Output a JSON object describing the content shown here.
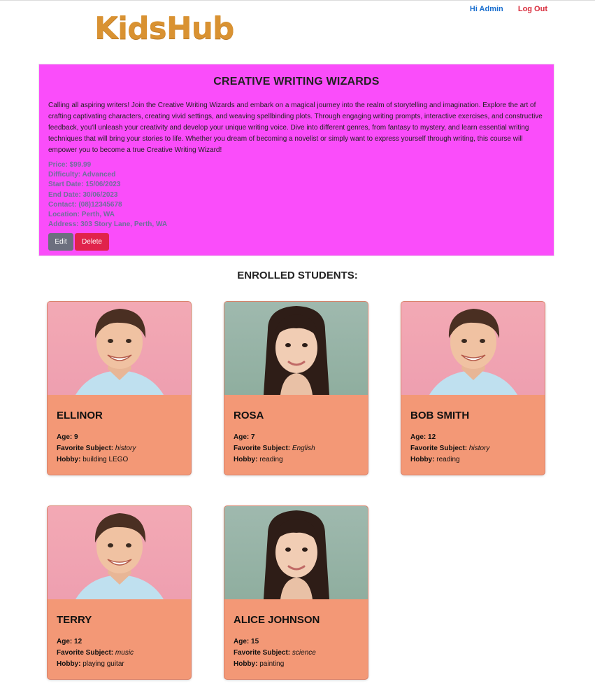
{
  "header": {
    "logo": "KidsHub",
    "greeting": "Hi Admin",
    "logout": "Log Out"
  },
  "course": {
    "title": "CREATIVE WRITING WIZARDS",
    "description": "Calling all aspiring writers! Join the Creative Writing Wizards and embark on a magical journey into the realm of storytelling and imagination. Explore the art of crafting captivating characters, creating vivid settings, and weaving spellbinding plots. Through engaging writing prompts, interactive exercises, and constructive feedback, you'll unleash your creativity and develop your unique writing voice. Dive into different genres, from fantasy to mystery, and learn essential writing techniques that will bring your stories to life. Whether you dream of becoming a novelist or simply want to express yourself through writing, this course will empower you to become a true Creative Writing Wizard!",
    "price": "Price: $99.99",
    "difficulty": "Difficulty: Advanced",
    "start_date": "Start Date: 15/06/2023",
    "end_date": "End Date: 30/06/2023",
    "contact": "Contact: (08)12345678",
    "location": "Location: Perth, WA",
    "address": "Address: 303 Story Lane, Perth, WA",
    "edit_label": "Edit",
    "delete_label": "Delete",
    "background_color": "#fa4dfa"
  },
  "students_heading": "ENROLLED STUDENTS:",
  "labels": {
    "age": "Age:",
    "subject": "Favorite Subject:",
    "hobby": "Hobby:"
  },
  "students": [
    {
      "name": "ELLINOR",
      "age": "9",
      "subject": "history",
      "hobby": "building LEGO",
      "photo": "boy"
    },
    {
      "name": "ROSA",
      "age": "7",
      "subject": "English",
      "hobby": "reading",
      "photo": "girl"
    },
    {
      "name": "BOB SMITH",
      "age": "12",
      "subject": "history",
      "hobby": "reading",
      "photo": "boy"
    },
    {
      "name": "TERRY",
      "age": "12",
      "subject": "music",
      "hobby": "playing guitar",
      "photo": "boy"
    },
    {
      "name": "ALICE JOHNSON",
      "age": "15",
      "subject": "science",
      "hobby": "painting",
      "photo": "girl"
    }
  ],
  "colors": {
    "logo": "#d99232",
    "card": "#f39876",
    "link_blue": "#1a6fcf",
    "link_red": "#d82a3a"
  }
}
